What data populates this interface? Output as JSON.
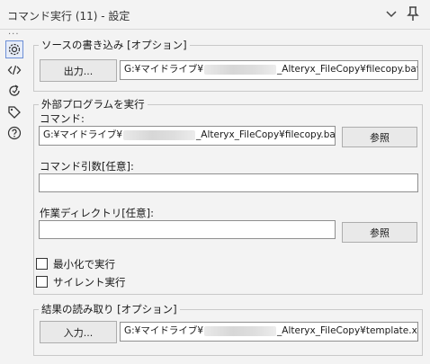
{
  "window": {
    "title": "コマンド実行 (11) - 設定"
  },
  "sidebar": {
    "more": "...",
    "icons": [
      "gear-icon",
      "code-icon",
      "refresh-icon",
      "tag-icon",
      "help-icon"
    ]
  },
  "source_write": {
    "legend": "ソースの書き込み [オプション]",
    "button_label": "出力...",
    "path_prefix": "G:¥マイドライブ¥",
    "path_suffix": "_Alteryx_FileCopy¥filecopy.bat"
  },
  "external_program": {
    "legend": "外部プログラムを実行",
    "command_label": "コマンド:",
    "command_prefix": "G:¥マイドライブ¥",
    "command_suffix": "_Alteryx_FileCopy¥filecopy.bat",
    "browse_label": "参照",
    "args_label": "コマンド引数[任意]:",
    "args_value": "",
    "workdir_label": "作業ディレクトリ[任意]:",
    "workdir_value": "",
    "browse2_label": "参照",
    "minimize_label": "最小化で実行",
    "minimize_checked": false,
    "silent_label": "サイレント実行",
    "silent_checked": false
  },
  "result_read": {
    "legend": "結果の読み取り [オプション]",
    "button_label": "入力...",
    "path_prefix": "G:¥マイドライブ¥",
    "path_suffix": "_Alteryx_FileCopy¥template.xlsx"
  }
}
